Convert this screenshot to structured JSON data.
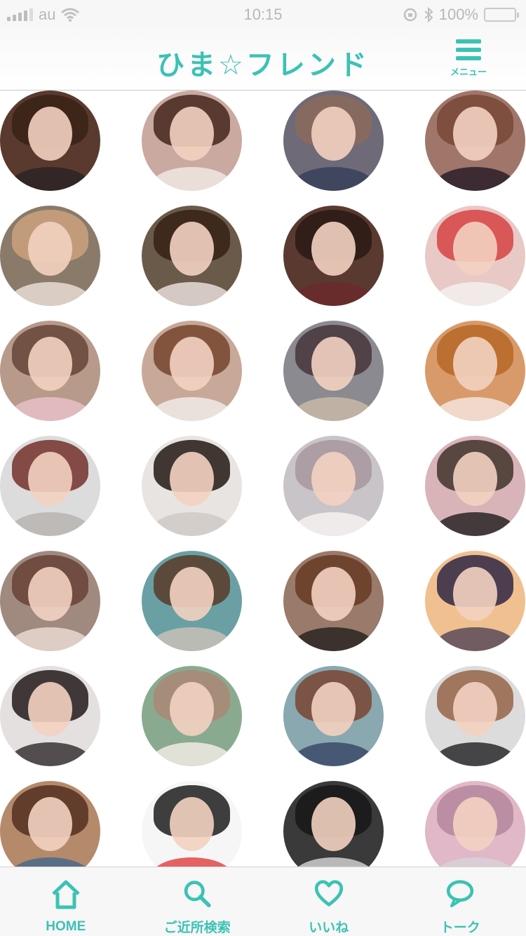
{
  "status_bar": {
    "carrier": "au",
    "time": "10:15",
    "battery_text": "100%",
    "battery_level": 1.0
  },
  "header": {
    "title": "ひま☆フレンド",
    "menu_label": "メニュー"
  },
  "colors": {
    "accent": "#3cc2b4",
    "divider": "#c8c8c8"
  },
  "profiles": [
    {
      "bg": "#5a3a2e",
      "hair": "#3b2418",
      "clothes": "#2c2424"
    },
    {
      "bg": "#c9a9a0",
      "hair": "#4b2e24",
      "clothes": "#efe7e2"
    },
    {
      "bg": "#6e6a78",
      "hair": "#8a6a5c",
      "clothes": "#3a3f5a"
    },
    {
      "bg": "#a0766a",
      "hair": "#7a4a3a",
      "clothes": "#2b1f2a"
    },
    {
      "bg": "#8a7a6a",
      "hair": "#c8a07c",
      "clothes": "#e8dcd2"
    },
    {
      "bg": "#6a5a4a",
      "hair": "#3a2418",
      "clothes": "#e6ded8"
    },
    {
      "bg": "#5a3a30",
      "hair": "#2e1c16",
      "clothes": "#6a2a2a"
    },
    {
      "bg": "#e8c9c6",
      "hair": "#d84a4a",
      "clothes": "#f2f0ee"
    },
    {
      "bg": "#b89a8a",
      "hair": "#6a4a3c",
      "clothes": "#e6c0c8"
    },
    {
      "bg": "#c8a898",
      "hair": "#7a4a34",
      "clothes": "#f0ebe6"
    },
    {
      "bg": "#8a8a90",
      "hair": "#4a3a40",
      "clothes": "#c8b8a8"
    },
    {
      "bg": "#d89a6a",
      "hair": "#b86a2a",
      "clothes": "#f4e4dc"
    },
    {
      "bg": "#dcdcdc",
      "hair": "#7a3a34",
      "clothes": "#b8b4b0"
    },
    {
      "bg": "#e8e4e2",
      "hair": "#2e2420",
      "clothes": "#cfcac6"
    },
    {
      "bg": "#c8c4c8",
      "hair": "#a89aa0",
      "clothes": "#f4f2f0"
    },
    {
      "bg": "#d8b4b8",
      "hair": "#4a3a34",
      "clothes": "#2a2424"
    },
    {
      "bg": "#a08a80",
      "hair": "#6a4638",
      "clothes": "#e8d8d0"
    },
    {
      "bg": "#6aa0a4",
      "hair": "#5a4030",
      "clothes": "#c8c0b8"
    },
    {
      "bg": "#9a7a6a",
      "hair": "#6a3e28",
      "clothes": "#2a2422"
    },
    {
      "bg": "#f0c090",
      "hair": "#3a3048",
      "clothes": "#5a4a5a"
    },
    {
      "bg": "#e4e0e0",
      "hair": "#2e2626",
      "clothes": "#3a3236"
    },
    {
      "bg": "#8aaa90",
      "hair": "#a88a78",
      "clothes": "#f0ebe4"
    },
    {
      "bg": "#8aa8b0",
      "hair": "#7a4a3a",
      "clothes": "#3a4a6a"
    },
    {
      "bg": "#dcdcdc",
      "hair": "#9a6a50",
      "clothes": "#2a2a2e"
    },
    {
      "bg": "#b48a6a",
      "hair": "#5a3426",
      "clothes": "#4a6a8a"
    },
    {
      "bg": "#f6f6f6",
      "hair": "#2a2a2a",
      "clothes": "#e04848"
    },
    {
      "bg": "#3a3a3a",
      "hair": "#1a1a1a",
      "clothes": "#cfcfcf"
    },
    {
      "bg": "#e0b8c8",
      "hair": "#b88aa0",
      "clothes": "#d8d0d8"
    }
  ],
  "tabs": [
    {
      "label": "HOME",
      "icon": "home-icon"
    },
    {
      "label": "ご近所検索",
      "icon": "search-icon"
    },
    {
      "label": "いいね",
      "icon": "heart-icon"
    },
    {
      "label": "トーク",
      "icon": "chat-icon"
    }
  ]
}
